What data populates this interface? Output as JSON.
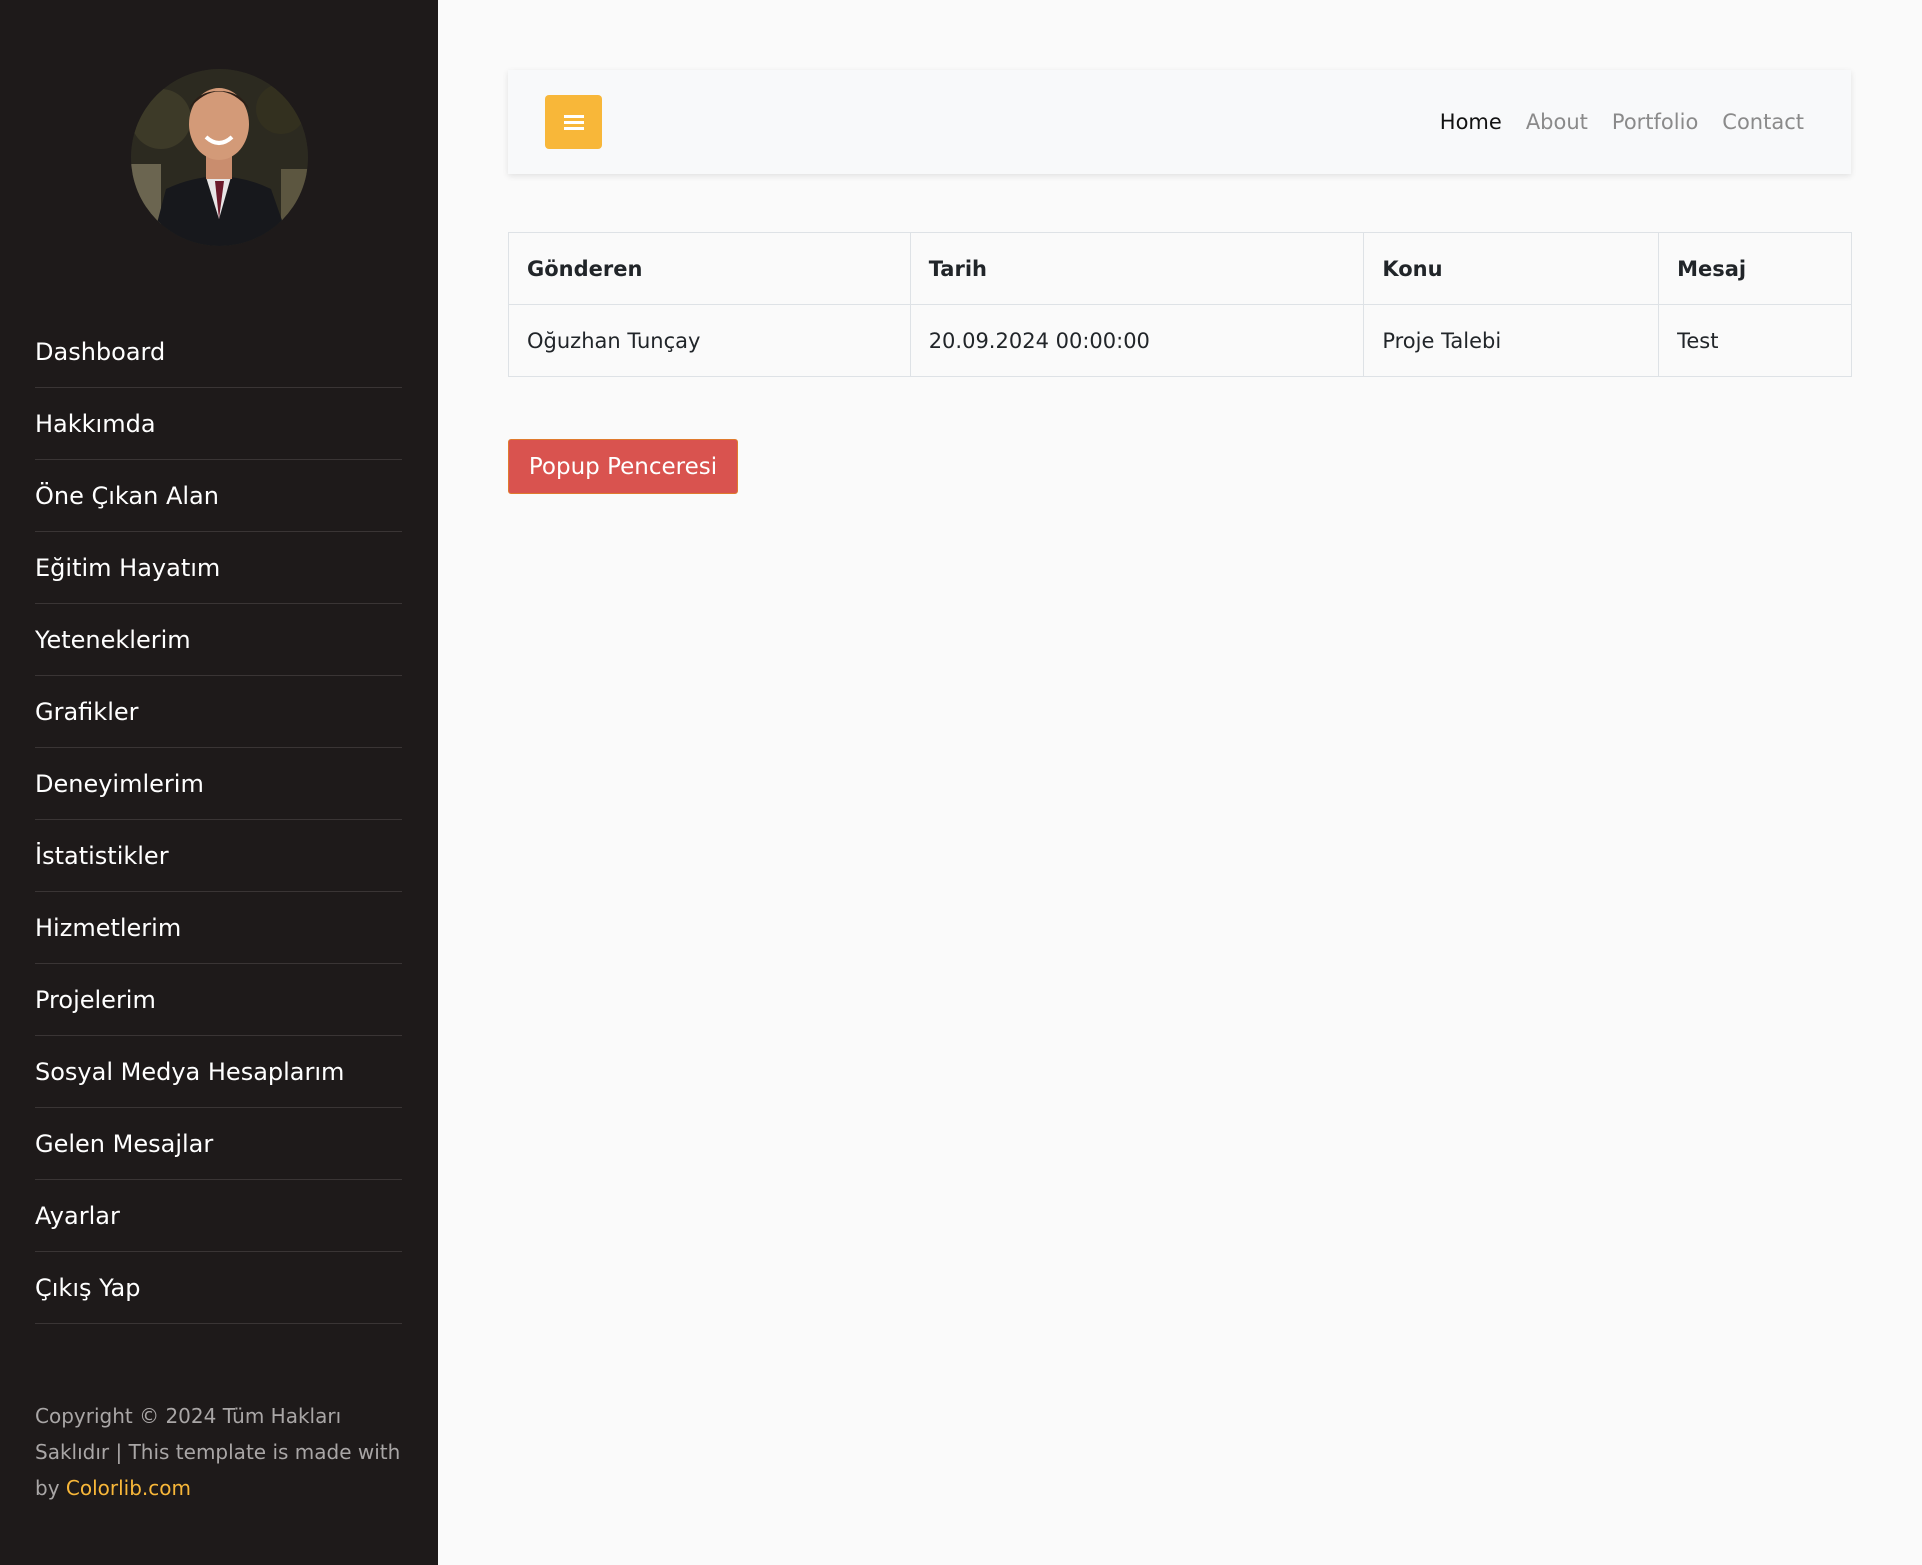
{
  "sidebar": {
    "avatar_alt": "profile photo",
    "menu": [
      {
        "label": "Dashboard"
      },
      {
        "label": "Hakkımda"
      },
      {
        "label": "Öne Çıkan Alan"
      },
      {
        "label": "Eğitim Hayatım"
      },
      {
        "label": "Yeteneklerim"
      },
      {
        "label": "Grafikler"
      },
      {
        "label": "Deneyimlerim"
      },
      {
        "label": "İstatistikler"
      },
      {
        "label": "Hizmetlerim"
      },
      {
        "label": "Projelerim"
      },
      {
        "label": "Sosyal Medya Hesaplarım"
      },
      {
        "label": "Gelen Mesajlar"
      },
      {
        "label": "Ayarlar"
      },
      {
        "label": "Çıkış Yap"
      }
    ],
    "footer": {
      "text": "Copyright © 2024 Tüm Hakları Saklıdır | This template is made with by",
      "link_text": "Colorlib.com"
    }
  },
  "navbar": {
    "toggle_icon": "hamburger-menu-icon",
    "links": [
      {
        "label": "Home",
        "active": true
      },
      {
        "label": "About",
        "active": false
      },
      {
        "label": "Portfolio",
        "active": false
      },
      {
        "label": "Contact",
        "active": false
      }
    ]
  },
  "table": {
    "headers": [
      "Gönderen",
      "Tarih",
      "Konu",
      "Mesaj"
    ],
    "rows": [
      [
        "Oğuzhan Tunçay",
        "20.09.2024 00:00:00",
        "Proje Talebi",
        "Test"
      ]
    ]
  },
  "popup_button": {
    "label": "Popup Penceresi"
  },
  "colors": {
    "sidebar_bg": "#1e1a1a",
    "accent": "#f8b739",
    "danger": "#d9534f"
  }
}
